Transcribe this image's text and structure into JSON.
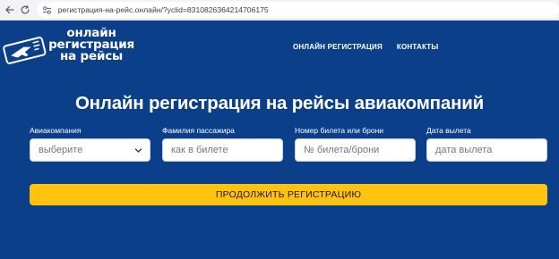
{
  "browser": {
    "url": "регистрация-на-рейс.онлайн/?yclid=8310826364214706175"
  },
  "header": {
    "logo_lines": [
      "онлайн",
      "регистрация",
      "на рейсы"
    ],
    "menu": [
      "ОНЛАЙН РЕГИСТРАЦИЯ",
      "КОНТАКТЫ"
    ]
  },
  "main": {
    "title": "Онлайн регистрация на рейсы авиакомпаний",
    "fields": [
      {
        "label": "Авиакомпания",
        "value": "выберите"
      },
      {
        "label": "Фамилия пассажира",
        "placeholder": "как в билете"
      },
      {
        "label": "Номер билета или брони",
        "placeholder": "№ билета/брони"
      },
      {
        "label": "Дата вылета",
        "placeholder": "дата вылета"
      }
    ],
    "submit_label": "ПРОДОЛЖИТЬ РЕГИСТРАЦИЮ"
  },
  "colors": {
    "background": "#0c3f8a",
    "button": "#ffc20e"
  },
  "icons": [
    "back-arrow-icon",
    "reload-icon",
    "site-settings-icon",
    "airplane-logo-icon",
    "chevron-down-icon"
  ]
}
